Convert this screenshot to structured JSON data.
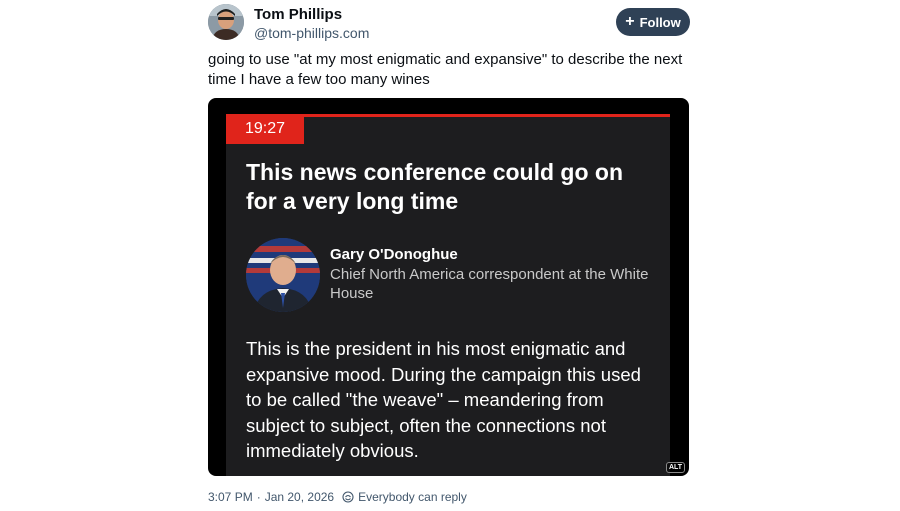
{
  "author": {
    "display_name": "Tom Phillips",
    "handle": "@tom-phillips.com",
    "avatar_icon": "user-avatar"
  },
  "follow_button": {
    "label": "Follow",
    "icon": "plus-icon",
    "background": "#2f4156"
  },
  "post": {
    "text": "going to use \"at my most enigmatic and expansive\" to describe the next time I have a few too many wines"
  },
  "embedded_image": {
    "time": "19:27",
    "headline": "This news conference could go on for a very long time",
    "contributor_name": "Gary O'Donoghue",
    "contributor_role": "Chief North America correspondent at the White House",
    "body": "This is the president in his most enigmatic and expansive mood. During the campaign this used to be called \"the weave\" – meandering from subject to subject, often the connections not immediately obvious.",
    "alt_label": "ALT",
    "accent_color": "#e0241b",
    "panel_color": "#1d1d1f"
  },
  "footer": {
    "timestamp": "3:07 PM",
    "separator": "·",
    "date": "Jan 20, 2026",
    "reply_setting": "Everybody can reply",
    "reply_icon": "reply-permission-icon"
  }
}
